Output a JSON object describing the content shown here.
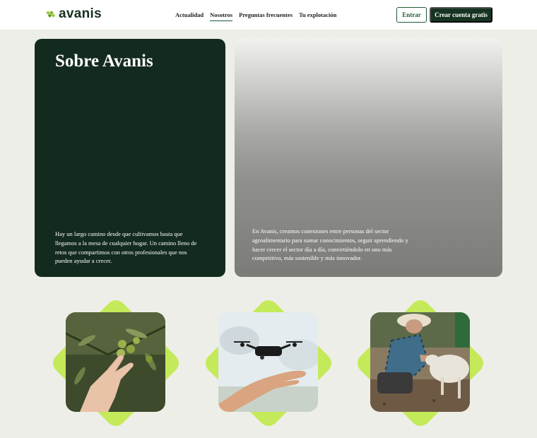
{
  "brand": {
    "name": "avanis",
    "color": "#17301f",
    "accent": "#c4ea5a"
  },
  "nav": {
    "items": [
      {
        "label": "Actualidad",
        "active": false
      },
      {
        "label": "Nosotros",
        "active": true
      },
      {
        "label": "Preguntas frecuentes",
        "active": false
      },
      {
        "label": "Tu explotación",
        "active": false
      }
    ]
  },
  "header": {
    "login_label": "Entrar",
    "signup_label": "Crear cuenta gratis"
  },
  "about": {
    "title": "Sobre Avanis",
    "intro": "Hay un largo camino desde que cultivamos hasta que llegamos a la mesa de cualquier hogar. Un camino lleno de retos que compartimos con otros profesionales que nos pueden ayudar a crecer.",
    "mission": "En Avanis, creamos conexiones entre personas del sector agroalimentario para sumar conocimientos, seguir aprendiendo y hacer crecer el sector día a día, convirtiéndolo en uno más competitivo, más sostenible y más innovador."
  },
  "features": [
    {
      "image": "hand-picking-olives"
    },
    {
      "image": "drone-over-hand"
    },
    {
      "image": "farmer-with-sheep"
    }
  ]
}
